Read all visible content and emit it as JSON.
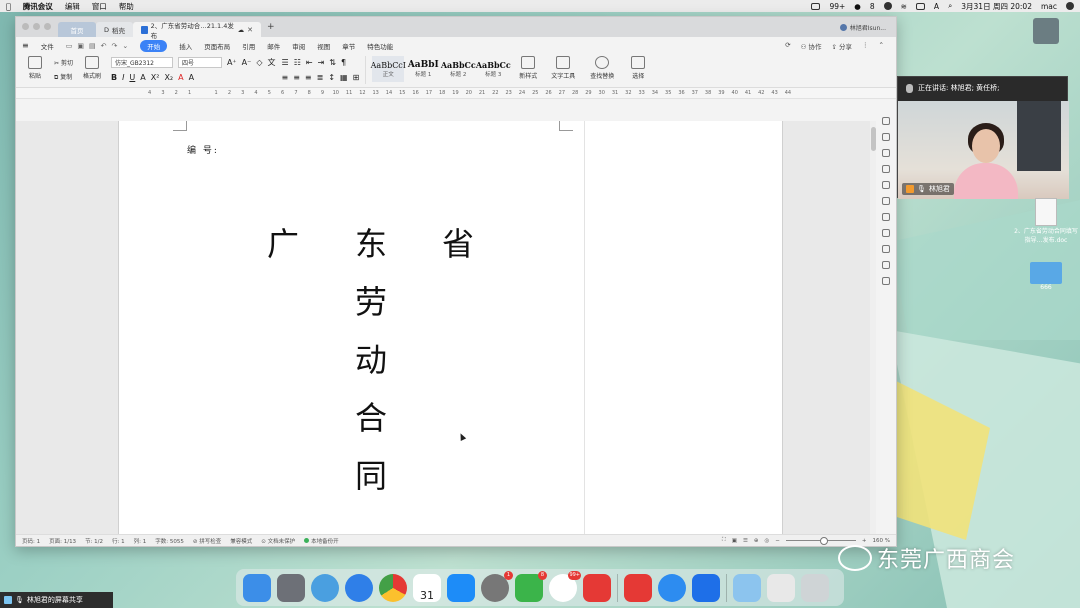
{
  "menubar": {
    "app_name": "腾讯会议",
    "menus": [
      "编辑",
      "窗口",
      "帮助"
    ],
    "status_badge": "99+",
    "status_count": "8",
    "input_indicator": "A",
    "datetime": "3月31日 周四 20:02",
    "user": "mac"
  },
  "window": {
    "tabs": {
      "home": "首页",
      "docs": "稻壳",
      "active": "2、广东省劳动合…21.1.4发布"
    },
    "account": "林旭君Isun..."
  },
  "menu": {
    "file": "文件",
    "items": [
      "开始",
      "插入",
      "页面布局",
      "引用",
      "邮件",
      "审阅",
      "视图",
      "章节",
      "特色功能"
    ],
    "active": "开始",
    "collab": "协作",
    "share": "分享"
  },
  "ribbon": {
    "paste": "粘贴",
    "cut": "剪切",
    "copy": "复制",
    "format_painter": "格式刷",
    "font_name": "仿宋_GB2312",
    "font_size": "四号",
    "styles": [
      {
        "sample": "AaBbCcI",
        "name": "正文"
      },
      {
        "sample": "AaBbI",
        "name": "标题 1"
      },
      {
        "sample": "AaBbCc",
        "name": "标题 2"
      },
      {
        "sample": "AaBbCc",
        "name": "标题 3"
      }
    ],
    "new_style": "新样式",
    "text_tool": "文字工具",
    "find_replace": "查找替换",
    "select": "选择"
  },
  "ruler": [
    "4",
    "3",
    "2",
    "1",
    "",
    "1",
    "2",
    "3",
    "4",
    "5",
    "6",
    "7",
    "8",
    "9",
    "10",
    "11",
    "12",
    "13",
    "14",
    "15",
    "16",
    "17",
    "18",
    "19",
    "20",
    "21",
    "22",
    "23",
    "24",
    "25",
    "26",
    "27",
    "28",
    "29",
    "30",
    "31",
    "32",
    "33",
    "34",
    "35",
    "36",
    "37",
    "38",
    "39",
    "40",
    "41",
    "42",
    "43",
    "44"
  ],
  "document": {
    "serial_label": "编    号:",
    "title_row": [
      "广",
      "东",
      "省"
    ],
    "title_col": [
      "劳",
      "动",
      "合",
      "同"
    ]
  },
  "status": {
    "page": "页码: 1",
    "pages": "页面: 1/13",
    "section": "节: 1/2",
    "row": "行: 1",
    "col": "列: 1",
    "words": "字数: 5055",
    "spell": "拼写检查",
    "compat": "兼容模式",
    "protect": "文档未保护",
    "backup": "本地备份开",
    "zoom": "160 %"
  },
  "video": {
    "speaking": "正在讲话: 林旭君; 黄任桥;",
    "name": "林旭君"
  },
  "desktop": {
    "file_label": "2、广东省劳动合同填写指导…发布.doc",
    "folder_label": "666"
  },
  "dock_badges": {
    "activity": "1",
    "wechat": "8",
    "qq": "99+"
  },
  "dock_calendar_day": "31",
  "share_bar": "林旭君的屏幕共享",
  "watermark": "东莞广西商会"
}
